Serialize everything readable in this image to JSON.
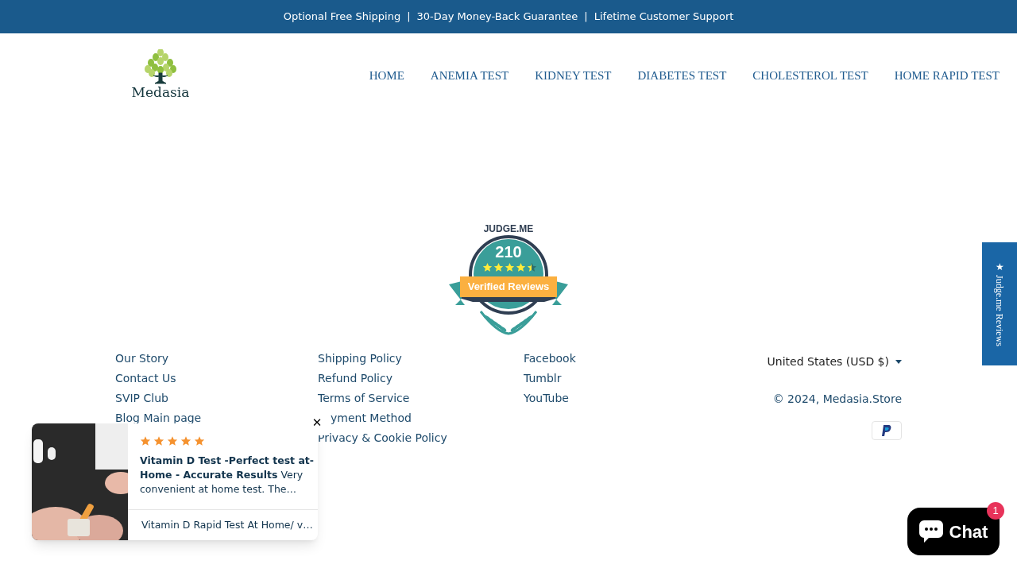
{
  "announcement": [
    "Optional Free Shipping",
    "|",
    "30-Day Money-Back Guarantee",
    "|",
    "Lifetime Customer Support"
  ],
  "logo": {
    "name": "Medasia"
  },
  "nav": [
    "HOME",
    "ANEMIA TEST",
    "KIDNEY TEST",
    "DIABETES TEST",
    "CHOLESTEROL TEST",
    "HOME RAPID TEST"
  ],
  "badge": {
    "brand": "JUDGE.ME",
    "count": "210",
    "stars": 4.5,
    "label": "Verified Reviews"
  },
  "footer_columns": [
    {
      "links": [
        "Our Story",
        "Contact Us",
        "SVIP Club",
        "Blog Main page"
      ]
    },
    {
      "links": [
        "Shipping Policy",
        "Refund Policy",
        "Terms of Service",
        "yment Method",
        "Privacy & Cookie Policy"
      ]
    },
    {
      "links": [
        "Facebook",
        "Tumblr",
        "YouTube"
      ]
    }
  ],
  "currency": {
    "value": "United States (USD $)"
  },
  "copyright": {
    "prefix": "© 2024, ",
    "link": "Medasia.Store"
  },
  "review_popup": {
    "stars": 5,
    "title": "Vitamin D Test -Perfect test at-Home - Accurate Results",
    "body": "Very convenient at home test. The…",
    "product": "Vitamin D Rapid Test At Home/ v…",
    "close": "✕"
  },
  "side_tab": {
    "label": "★ Judge.me Reviews"
  },
  "chat": {
    "label": "Chat",
    "count": "1"
  }
}
